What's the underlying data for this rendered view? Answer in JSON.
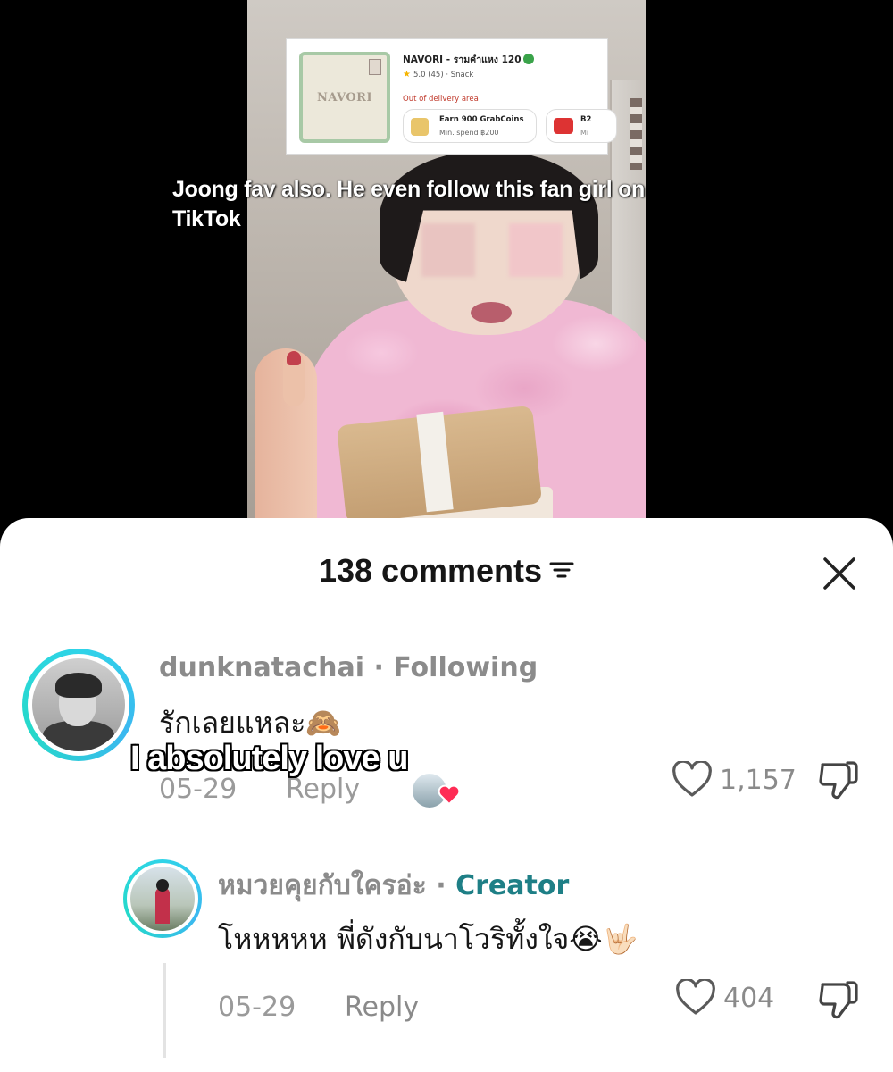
{
  "video": {
    "store_card": {
      "logo_text": "NAVORI",
      "name": "NAVORI - รามคำแหง 120",
      "rating": "5.0 (45) · Snack",
      "delivery_status": "Out of delivery area",
      "promo1_title": "Earn 900 GrabCoins",
      "promo1_sub": "Min. spend ฿200",
      "promo2_title": "B2",
      "promo2_sub": "Mi"
    },
    "caption": "Joong fav also. He even follow this fan girl on TikTok"
  },
  "comments_panel": {
    "count_label": "138 comments",
    "comments": [
      {
        "username": "dunknatachai · Following",
        "text": "รักเลยแหละ🙈",
        "overlay": "I absolutely love u",
        "date": "05-29",
        "reply_label": "Reply",
        "likes": "1,157"
      },
      {
        "username": "หมวยคุยกับใครอ่ะ ·",
        "badge": "Creator",
        "text": "โหหหหห พี่ดังกับนาโวริทั้งใจ😭🤟🏻",
        "date": "05-29",
        "reply_label": "Reply",
        "likes": "404"
      }
    ]
  },
  "colors": {
    "avatar_ring": "#2fd4e8",
    "creator_badge": "#1e7f86",
    "liked_heart": "#fe2c55"
  }
}
